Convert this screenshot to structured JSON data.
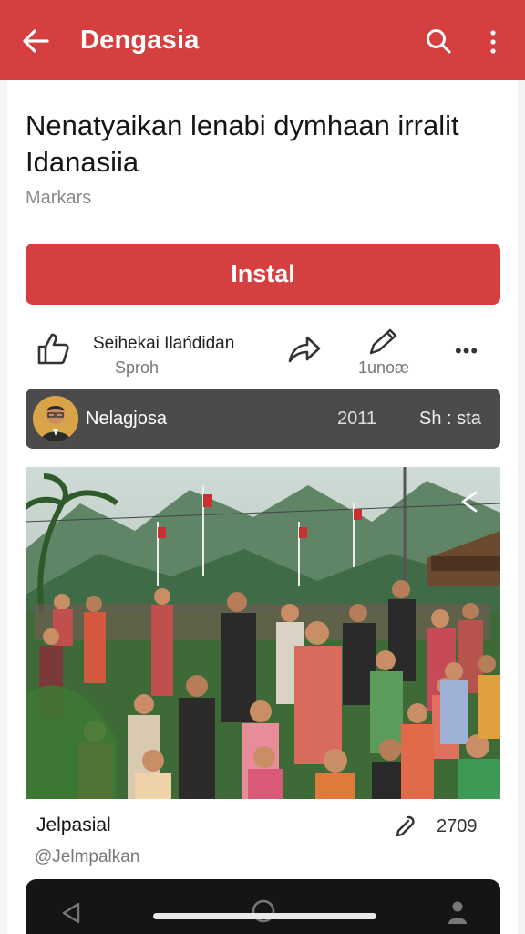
{
  "appbar": {
    "title": "Dengasia",
    "back_icon": "arrow-back-icon",
    "search_icon": "search-icon",
    "more_icon": "more-vert-icon",
    "color": "#d63f3f"
  },
  "app": {
    "headline": "Nenatyaikan lenabi dymhaan irralit Idanasiia",
    "meta": "Markars",
    "install_label": "Instal"
  },
  "actions": {
    "like_icon": "thumbs-up-icon",
    "title": "Seihekai Ilańdidan",
    "subtitle": "Sproh",
    "share_icon": "share-icon",
    "edit_icon": "edit-icon",
    "count": "1unoæ",
    "more_label": "•••"
  },
  "author": {
    "name": "Nelagjosa",
    "year": "2011",
    "status": "Sh : sta"
  },
  "photo": {
    "share_icon": "share-icon"
  },
  "caption": {
    "title": "Jelpasial",
    "handle": "@Jelmpalkan",
    "pin_icon": "pin-icon",
    "count": "2709"
  },
  "navbar": {
    "back_icon": "nav-back-icon",
    "home_icon": "home-icon",
    "person_icon": "person-icon"
  }
}
